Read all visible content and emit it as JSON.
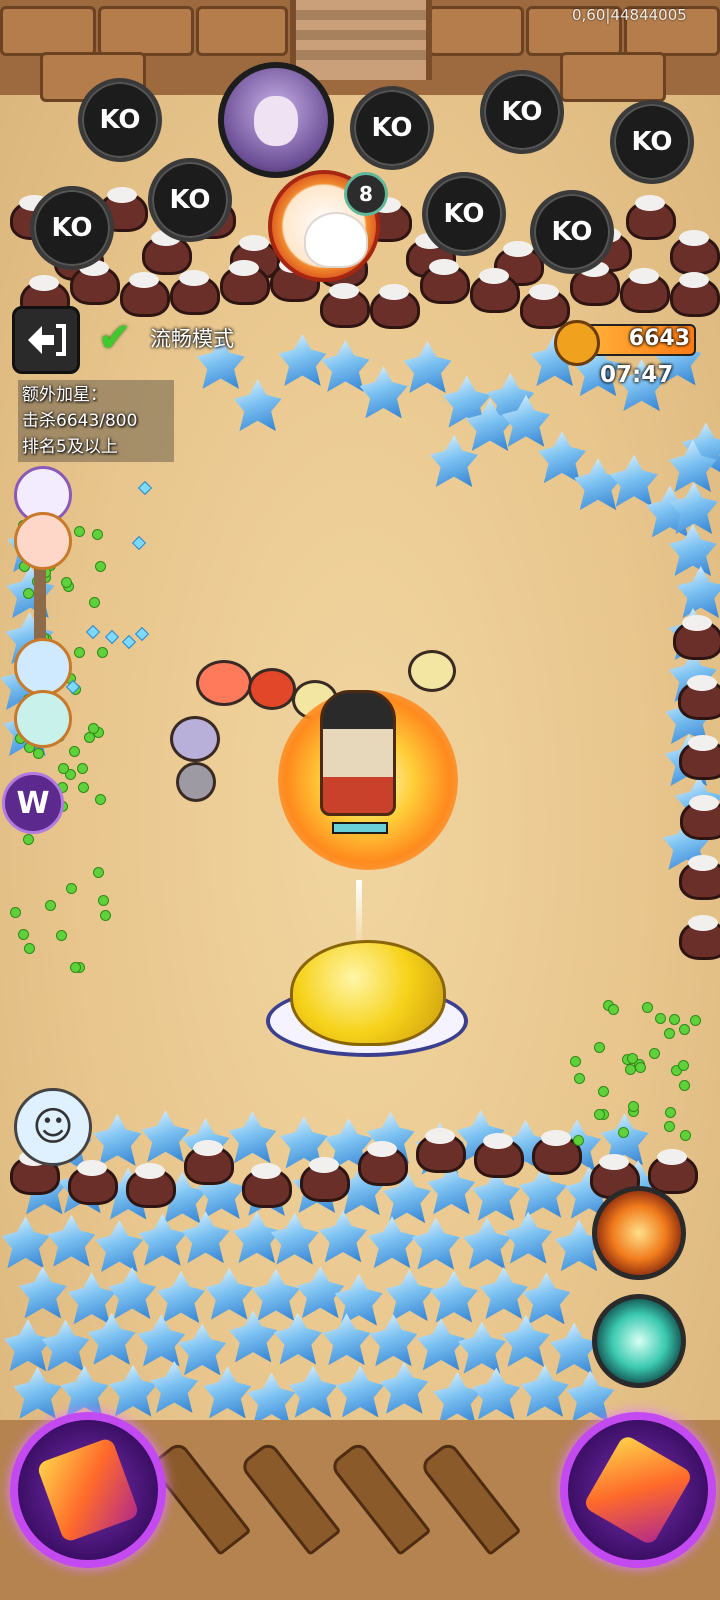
{
  "debug": {
    "tag": "0,60|44844005"
  },
  "hud": {
    "exit_icon": "exit-arrow-icon",
    "smooth_mode_label": "流畅模式",
    "bonus_lines": [
      "额外加星：",
      "击杀6643/800",
      "排名5及以上"
    ],
    "kill_count": "6643",
    "timer": "07:47"
  },
  "opponents": {
    "ko_label": "KO",
    "ko_badges": [
      "KO",
      "KO",
      "KO",
      "KO",
      "KO",
      "KO",
      "KO",
      "KO",
      "KO"
    ]
  },
  "player_badge": {
    "rank_number": "8"
  },
  "left_menu": {
    "w_badge": "W"
  },
  "chat": {
    "emoji_icon": "smile-wink-icon"
  },
  "skills": {
    "fire_skill_icon": "fire-gourd-icon",
    "wind_skill_icon": "wind-gourd-icon",
    "ultimate_left_icon": "warrior-ultimate-icon",
    "ultimate_right_icon": "flying-blades-icon"
  },
  "colors": {
    "accent_orange": "#ff7a12",
    "ultimate_purple": "#c34af0",
    "check_green": "#3ecb2d"
  }
}
